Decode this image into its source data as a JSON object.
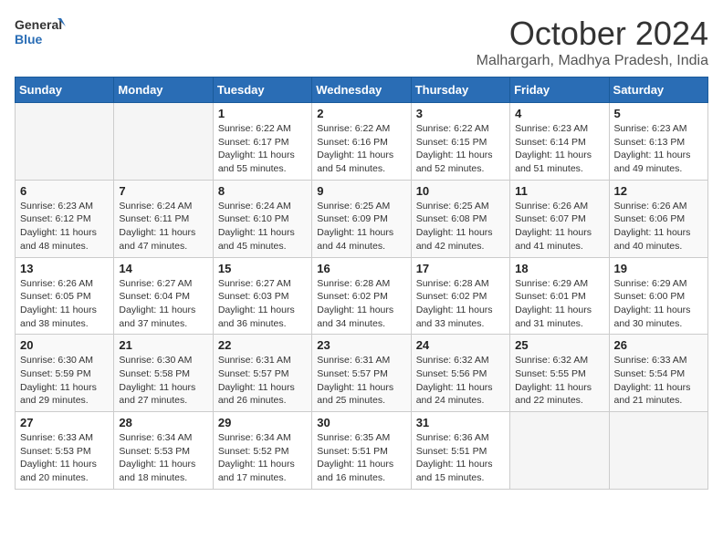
{
  "header": {
    "logo_general": "General",
    "logo_blue": "Blue",
    "month_title": "October 2024",
    "location": "Malhargarh, Madhya Pradesh, India"
  },
  "days_of_week": [
    "Sunday",
    "Monday",
    "Tuesday",
    "Wednesday",
    "Thursday",
    "Friday",
    "Saturday"
  ],
  "weeks": [
    [
      {
        "num": "",
        "sunrise": "",
        "sunset": "",
        "daylight": "",
        "empty": true
      },
      {
        "num": "",
        "sunrise": "",
        "sunset": "",
        "daylight": "",
        "empty": true
      },
      {
        "num": "1",
        "sunrise": "Sunrise: 6:22 AM",
        "sunset": "Sunset: 6:17 PM",
        "daylight": "Daylight: 11 hours and 55 minutes.",
        "empty": false
      },
      {
        "num": "2",
        "sunrise": "Sunrise: 6:22 AM",
        "sunset": "Sunset: 6:16 PM",
        "daylight": "Daylight: 11 hours and 54 minutes.",
        "empty": false
      },
      {
        "num": "3",
        "sunrise": "Sunrise: 6:22 AM",
        "sunset": "Sunset: 6:15 PM",
        "daylight": "Daylight: 11 hours and 52 minutes.",
        "empty": false
      },
      {
        "num": "4",
        "sunrise": "Sunrise: 6:23 AM",
        "sunset": "Sunset: 6:14 PM",
        "daylight": "Daylight: 11 hours and 51 minutes.",
        "empty": false
      },
      {
        "num": "5",
        "sunrise": "Sunrise: 6:23 AM",
        "sunset": "Sunset: 6:13 PM",
        "daylight": "Daylight: 11 hours and 49 minutes.",
        "empty": false
      }
    ],
    [
      {
        "num": "6",
        "sunrise": "Sunrise: 6:23 AM",
        "sunset": "Sunset: 6:12 PM",
        "daylight": "Daylight: 11 hours and 48 minutes.",
        "empty": false
      },
      {
        "num": "7",
        "sunrise": "Sunrise: 6:24 AM",
        "sunset": "Sunset: 6:11 PM",
        "daylight": "Daylight: 11 hours and 47 minutes.",
        "empty": false
      },
      {
        "num": "8",
        "sunrise": "Sunrise: 6:24 AM",
        "sunset": "Sunset: 6:10 PM",
        "daylight": "Daylight: 11 hours and 45 minutes.",
        "empty": false
      },
      {
        "num": "9",
        "sunrise": "Sunrise: 6:25 AM",
        "sunset": "Sunset: 6:09 PM",
        "daylight": "Daylight: 11 hours and 44 minutes.",
        "empty": false
      },
      {
        "num": "10",
        "sunrise": "Sunrise: 6:25 AM",
        "sunset": "Sunset: 6:08 PM",
        "daylight": "Daylight: 11 hours and 42 minutes.",
        "empty": false
      },
      {
        "num": "11",
        "sunrise": "Sunrise: 6:26 AM",
        "sunset": "Sunset: 6:07 PM",
        "daylight": "Daylight: 11 hours and 41 minutes.",
        "empty": false
      },
      {
        "num": "12",
        "sunrise": "Sunrise: 6:26 AM",
        "sunset": "Sunset: 6:06 PM",
        "daylight": "Daylight: 11 hours and 40 minutes.",
        "empty": false
      }
    ],
    [
      {
        "num": "13",
        "sunrise": "Sunrise: 6:26 AM",
        "sunset": "Sunset: 6:05 PM",
        "daylight": "Daylight: 11 hours and 38 minutes.",
        "empty": false
      },
      {
        "num": "14",
        "sunrise": "Sunrise: 6:27 AM",
        "sunset": "Sunset: 6:04 PM",
        "daylight": "Daylight: 11 hours and 37 minutes.",
        "empty": false
      },
      {
        "num": "15",
        "sunrise": "Sunrise: 6:27 AM",
        "sunset": "Sunset: 6:03 PM",
        "daylight": "Daylight: 11 hours and 36 minutes.",
        "empty": false
      },
      {
        "num": "16",
        "sunrise": "Sunrise: 6:28 AM",
        "sunset": "Sunset: 6:02 PM",
        "daylight": "Daylight: 11 hours and 34 minutes.",
        "empty": false
      },
      {
        "num": "17",
        "sunrise": "Sunrise: 6:28 AM",
        "sunset": "Sunset: 6:02 PM",
        "daylight": "Daylight: 11 hours and 33 minutes.",
        "empty": false
      },
      {
        "num": "18",
        "sunrise": "Sunrise: 6:29 AM",
        "sunset": "Sunset: 6:01 PM",
        "daylight": "Daylight: 11 hours and 31 minutes.",
        "empty": false
      },
      {
        "num": "19",
        "sunrise": "Sunrise: 6:29 AM",
        "sunset": "Sunset: 6:00 PM",
        "daylight": "Daylight: 11 hours and 30 minutes.",
        "empty": false
      }
    ],
    [
      {
        "num": "20",
        "sunrise": "Sunrise: 6:30 AM",
        "sunset": "Sunset: 5:59 PM",
        "daylight": "Daylight: 11 hours and 29 minutes.",
        "empty": false
      },
      {
        "num": "21",
        "sunrise": "Sunrise: 6:30 AM",
        "sunset": "Sunset: 5:58 PM",
        "daylight": "Daylight: 11 hours and 27 minutes.",
        "empty": false
      },
      {
        "num": "22",
        "sunrise": "Sunrise: 6:31 AM",
        "sunset": "Sunset: 5:57 PM",
        "daylight": "Daylight: 11 hours and 26 minutes.",
        "empty": false
      },
      {
        "num": "23",
        "sunrise": "Sunrise: 6:31 AM",
        "sunset": "Sunset: 5:57 PM",
        "daylight": "Daylight: 11 hours and 25 minutes.",
        "empty": false
      },
      {
        "num": "24",
        "sunrise": "Sunrise: 6:32 AM",
        "sunset": "Sunset: 5:56 PM",
        "daylight": "Daylight: 11 hours and 24 minutes.",
        "empty": false
      },
      {
        "num": "25",
        "sunrise": "Sunrise: 6:32 AM",
        "sunset": "Sunset: 5:55 PM",
        "daylight": "Daylight: 11 hours and 22 minutes.",
        "empty": false
      },
      {
        "num": "26",
        "sunrise": "Sunrise: 6:33 AM",
        "sunset": "Sunset: 5:54 PM",
        "daylight": "Daylight: 11 hours and 21 minutes.",
        "empty": false
      }
    ],
    [
      {
        "num": "27",
        "sunrise": "Sunrise: 6:33 AM",
        "sunset": "Sunset: 5:53 PM",
        "daylight": "Daylight: 11 hours and 20 minutes.",
        "empty": false
      },
      {
        "num": "28",
        "sunrise": "Sunrise: 6:34 AM",
        "sunset": "Sunset: 5:53 PM",
        "daylight": "Daylight: 11 hours and 18 minutes.",
        "empty": false
      },
      {
        "num": "29",
        "sunrise": "Sunrise: 6:34 AM",
        "sunset": "Sunset: 5:52 PM",
        "daylight": "Daylight: 11 hours and 17 minutes.",
        "empty": false
      },
      {
        "num": "30",
        "sunrise": "Sunrise: 6:35 AM",
        "sunset": "Sunset: 5:51 PM",
        "daylight": "Daylight: 11 hours and 16 minutes.",
        "empty": false
      },
      {
        "num": "31",
        "sunrise": "Sunrise: 6:36 AM",
        "sunset": "Sunset: 5:51 PM",
        "daylight": "Daylight: 11 hours and 15 minutes.",
        "empty": false
      },
      {
        "num": "",
        "sunrise": "",
        "sunset": "",
        "daylight": "",
        "empty": true
      },
      {
        "num": "",
        "sunrise": "",
        "sunset": "",
        "daylight": "",
        "empty": true
      }
    ]
  ]
}
